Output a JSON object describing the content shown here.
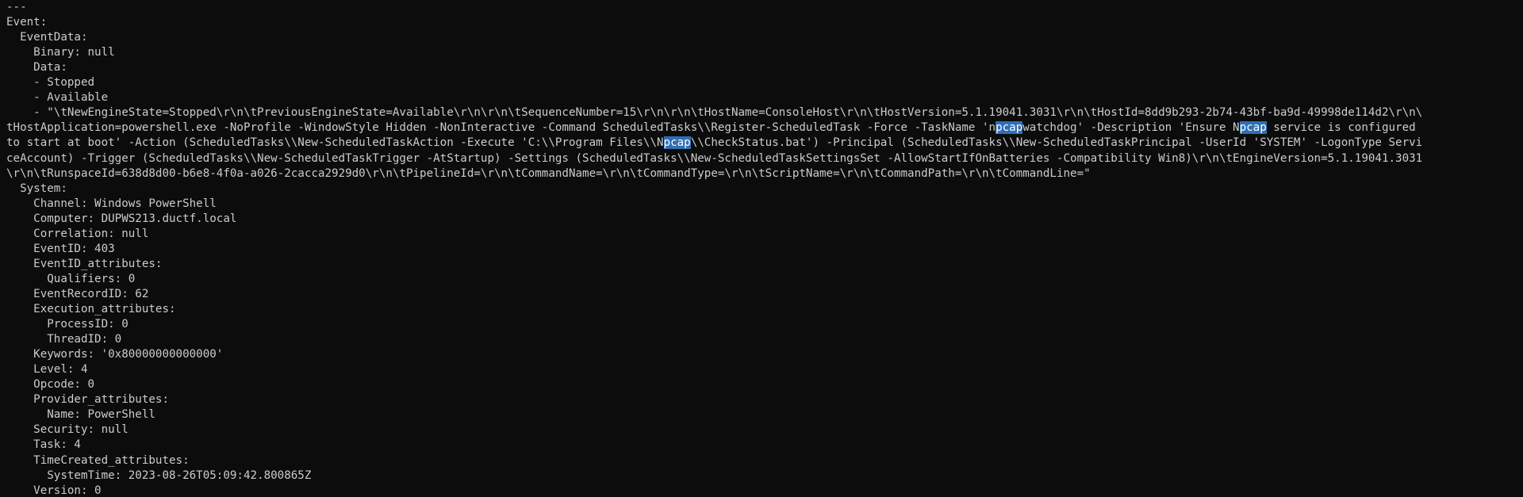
{
  "terminal": {
    "lines": [
      "---",
      "Event:",
      "  EventData:",
      "    Binary: null",
      "    Data:",
      "    - Stopped",
      "    - Available",
      "    - \"\\tNewEngineState=Stopped\\r\\n\\tPreviousEngineState=Available\\r\\n\\r\\n\\tSequenceNumber=15\\r\\n\\r\\n\\tHostName=ConsoleHost\\r\\n\\tHostVersion=5.1.19041.3031\\r\\n\\tHostId=8dd9b293-2b74-43bf-ba9d-49998de114d2\\r\\n\\",
      "tHostApplication=powershell.exe -NoProfile -WindowStyle Hidden -NonInteractive -Command ScheduledTasks\\\\Register-ScheduledTask -Force -TaskName 'npcapwatchdog' -Description 'Ensure Npcap service is configured",
      "to start at boot' -Action (ScheduledTasks\\\\New-ScheduledTaskAction -Execute 'C:\\\\Program Files\\\\Npcap\\\\CheckStatus.bat') -Principal (ScheduledTasks\\\\New-ScheduledTaskPrincipal -UserId 'SYSTEM' -LogonType Servi",
      "ceAccount) -Trigger (ScheduledTasks\\\\New-ScheduledTaskTrigger -AtStartup) -Settings (ScheduledTasks\\\\New-ScheduledTaskSettingsSet -AllowStartIfOnBatteries -Compatibility Win8)\\r\\n\\tEngineVersion=5.1.19041.3031",
      "\\r\\n\\tRunspaceId=638d8d00-b6e8-4f0a-a026-2cacca2929d0\\r\\n\\tPipelineId=\\r\\n\\tCommandName=\\r\\n\\tCommandType=\\r\\n\\tScriptName=\\r\\n\\tCommandPath=\\r\\n\\tCommandLine=\"",
      "  System:",
      "    Channel: Windows PowerShell",
      "    Computer: DUPWS213.ductf.local",
      "    Correlation: null",
      "    EventID: 403",
      "    EventID_attributes:",
      "      Qualifiers: 0",
      "    EventRecordID: 62",
      "    Execution_attributes:",
      "      ProcessID: 0",
      "      ThreadID: 0",
      "    Keywords: '0x80000000000000'",
      "    Level: 4",
      "    Opcode: 0",
      "    Provider_attributes:",
      "      Name: PowerShell",
      "    Security: null",
      "    Task: 4",
      "    TimeCreated_attributes:",
      "      SystemTime: 2023-08-26T05:09:42.800865Z",
      "    Version: 0"
    ],
    "search_highlight": "pcap",
    "colors": {
      "background": "#0c0c0c",
      "foreground": "#cccccc",
      "highlight_background": "#2f6fb5",
      "highlight_foreground": "#ffffff"
    }
  }
}
